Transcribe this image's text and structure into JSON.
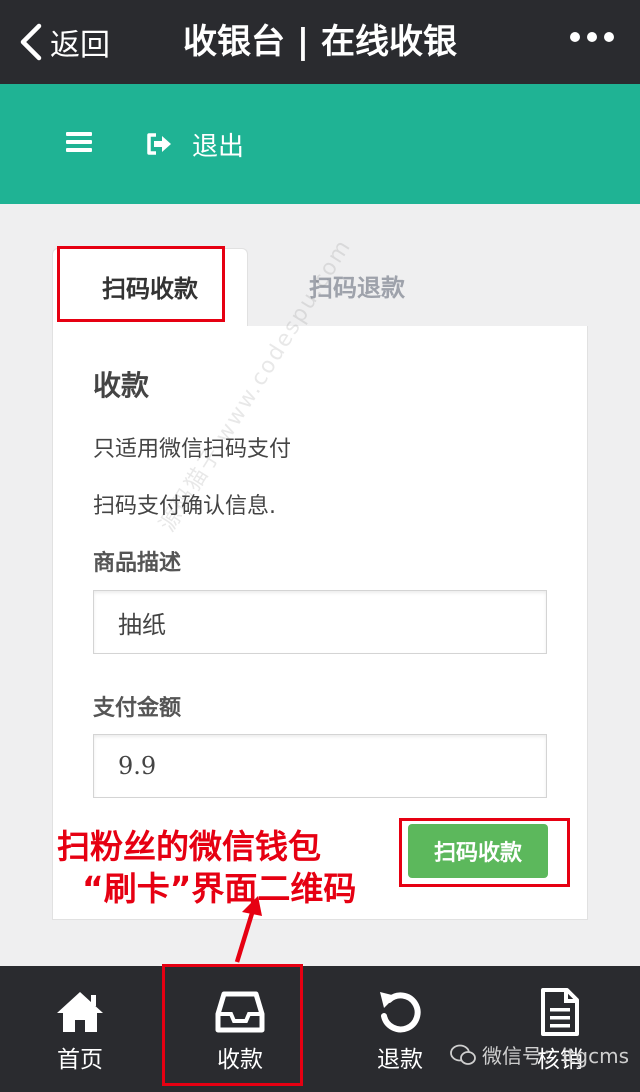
{
  "topbar": {
    "back_label": "返回",
    "title": "收银台 | 在线收银"
  },
  "header": {
    "logout_label": "退出"
  },
  "tabs": [
    {
      "label": "扫码收款",
      "active": true
    },
    {
      "label": "扫码退款",
      "active": false
    }
  ],
  "panel": {
    "title": "收款",
    "desc1": "只适用微信扫码支付",
    "desc2": "扫码支付确认信息.",
    "desc_label": "商品描述",
    "desc_value": "抽纸",
    "amount_label": "支付金额",
    "amount_value": "9.9",
    "submit_label": "扫码收款"
  },
  "watermark": "源码猫子 www.codespu.com",
  "annotation": {
    "line1": "扫粉丝的微信钱包",
    "line2": "“刷卡”界面二维码"
  },
  "nav": [
    {
      "label": "首页",
      "icon": "home-icon"
    },
    {
      "label": "收款",
      "icon": "inbox-icon"
    },
    {
      "label": "退款",
      "icon": "refresh-icon"
    },
    {
      "label": "核销",
      "icon": "document-icon"
    }
  ],
  "wechat_mark": "微信号：itgcms",
  "colors": {
    "topbar": "#2a2b2f",
    "header": "#1fb394",
    "button": "#5cb85c",
    "annotation": "#e60012"
  }
}
